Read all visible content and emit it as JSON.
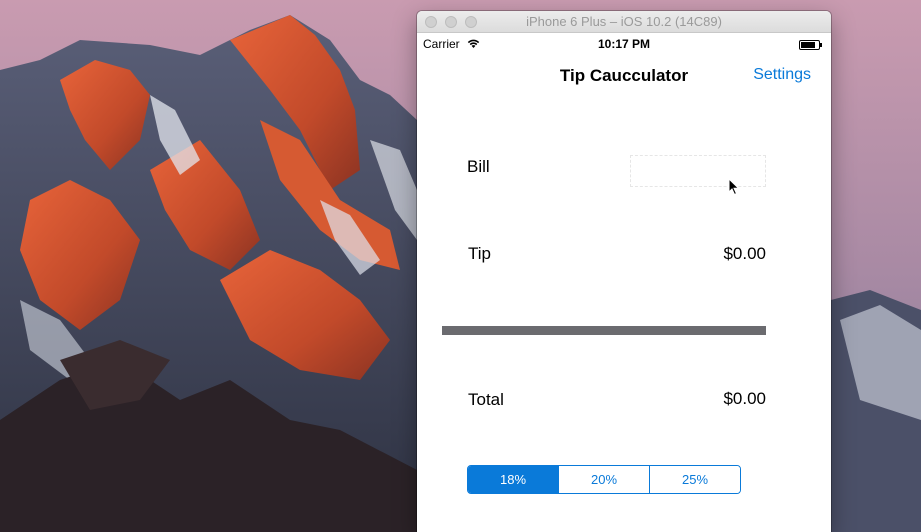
{
  "window": {
    "title": "iPhone 6 Plus – iOS 10.2 (14C89)"
  },
  "status_bar": {
    "carrier": "Carrier",
    "time": "10:17 PM",
    "icons": [
      "wifi-icon",
      "battery-icon"
    ]
  },
  "nav": {
    "title": "Tip Caucculator",
    "settings_label": "Settings"
  },
  "bill": {
    "label": "Bill",
    "value": "",
    "placeholder": ""
  },
  "tip": {
    "label": "Tip",
    "amount": "$0.00"
  },
  "total": {
    "label": "Total",
    "amount": "$0.00"
  },
  "tip_options": {
    "selected_index": 0,
    "options": [
      "18%",
      "20%",
      "25%"
    ]
  },
  "colors": {
    "accent": "#0a7ad9",
    "divider": "#6b6b6f"
  }
}
